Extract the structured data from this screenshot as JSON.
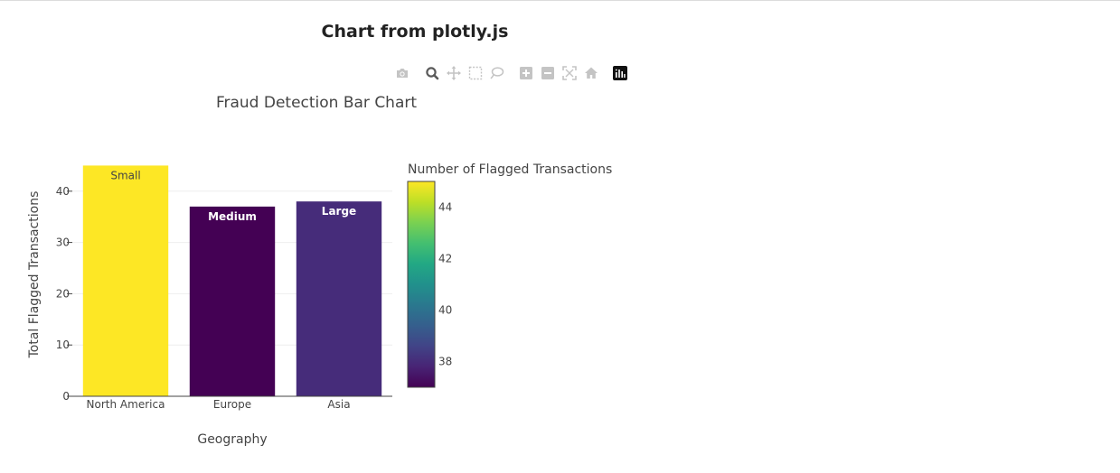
{
  "page": {
    "title": "Chart from plotly.js"
  },
  "modebar": {
    "buttons": [
      {
        "name": "camera-icon",
        "label": "Download plot as a png"
      },
      {
        "name": "zoom-icon",
        "label": "Zoom"
      },
      {
        "name": "pan-icon",
        "label": "Pan"
      },
      {
        "name": "box-select-icon",
        "label": "Box Select"
      },
      {
        "name": "lasso-select-icon",
        "label": "Lasso Select"
      },
      {
        "name": "zoom-in-icon",
        "label": "Zoom in"
      },
      {
        "name": "zoom-out-icon",
        "label": "Zoom out"
      },
      {
        "name": "autoscale-icon",
        "label": "Autoscale"
      },
      {
        "name": "home-icon",
        "label": "Reset axes"
      },
      {
        "name": "plotly-logo-icon",
        "label": "Produced with Plotly"
      }
    ],
    "active": "zoom-icon"
  },
  "chart_data": {
    "type": "bar",
    "title": "Fraud Detection Bar Chart",
    "xlabel": "Geography",
    "ylabel": "Total Flagged Transactions",
    "categories": [
      "North America",
      "Europe",
      "Asia"
    ],
    "values": [
      45,
      37,
      38
    ],
    "text": [
      "Small",
      "Medium",
      "Large"
    ],
    "ylim": [
      0,
      47.4
    ],
    "yticks": [
      0,
      10,
      20,
      30,
      40
    ],
    "grid": true,
    "colorbar": {
      "title": "Number of Flagged Transactions",
      "colorscale": "Viridis",
      "range": [
        37,
        45
      ],
      "ticks": [
        38,
        40,
        42,
        44
      ]
    },
    "colors": {
      "background": "#ffffff",
      "grid": "#eeeeee",
      "text": "#444444"
    }
  }
}
